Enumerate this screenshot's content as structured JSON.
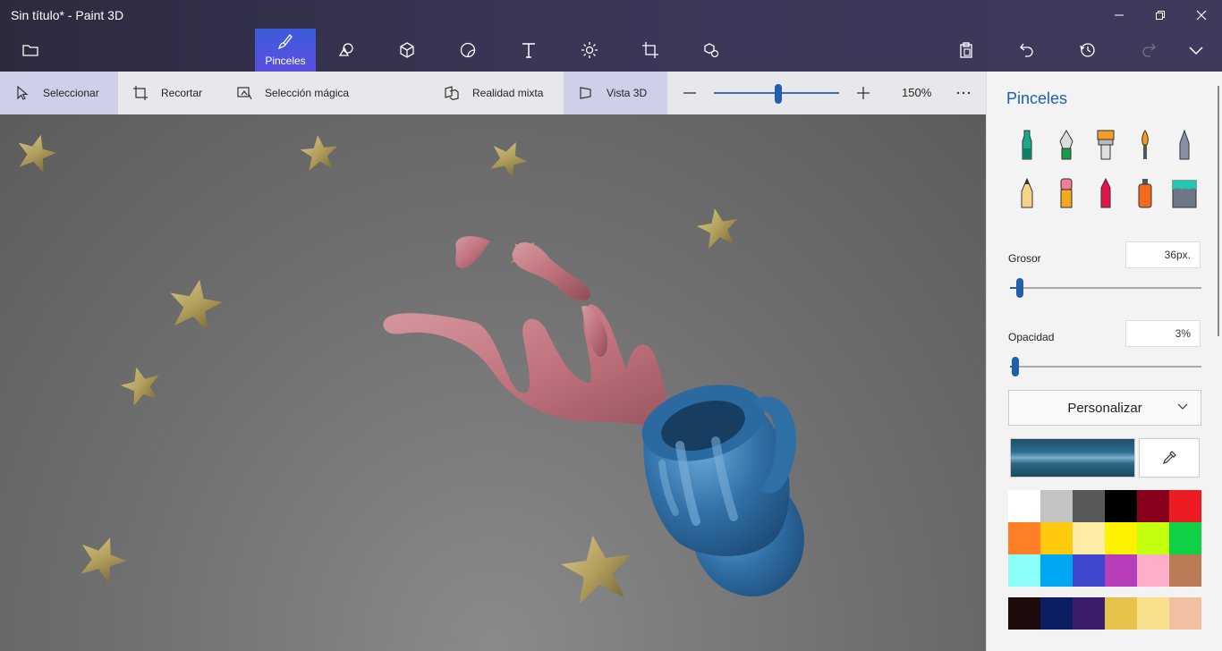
{
  "window": {
    "title": "Sin título* - Paint 3D"
  },
  "toolbar": {
    "active_label": "Pinceles",
    "icons": [
      "folder-icon",
      "brush-icon",
      "shapes-2d-icon",
      "shapes-3d-icon",
      "stickers-icon",
      "text-icon",
      "effects-icon",
      "canvas-icon",
      "library-3d-icon",
      "paste-icon",
      "undo-icon",
      "history-icon",
      "redo-icon",
      "expand-chevron-icon"
    ]
  },
  "subbar": {
    "select": "Seleccionar",
    "crop": "Recortar",
    "magic_select": "Selección mágica",
    "mixed_reality": "Realidad mixta",
    "view3d": "Vista 3D",
    "zoom": "150%",
    "zoom_level_percent": 50
  },
  "panel": {
    "title": "Pinceles",
    "brushes": [
      "marker",
      "calligraphy-pen",
      "oil-brush",
      "watercolor",
      "pixel-pen",
      "pencil",
      "eraser",
      "crayon",
      "spray-can",
      "fill"
    ],
    "thickness_label": "Grosor",
    "thickness_value": "36px.",
    "thickness_fraction": 0.05,
    "opacity_label": "Opacidad",
    "opacity_value": "3%",
    "opacity_fraction": 0.03,
    "finish": "Personalizar",
    "current_color": "#2d6e8e",
    "palette": [
      "#ffffff",
      "#c3c3c3",
      "#585858",
      "#000000",
      "#88001b",
      "#ec1c24",
      "#ff7f27",
      "#ffc90e",
      "#fdeca6",
      "#fff200",
      "#c4ff0e",
      "#0ed145",
      "#8cfffb",
      "#00a8f3",
      "#3f48cc",
      "#b83dba",
      "#ffaec8",
      "#b97a56"
    ],
    "custom_colors": [
      "#1e0c0d",
      "#0d1f64",
      "#3a1d6b",
      "#e6c44c",
      "#f9e08c",
      "#f2bfa2"
    ]
  }
}
